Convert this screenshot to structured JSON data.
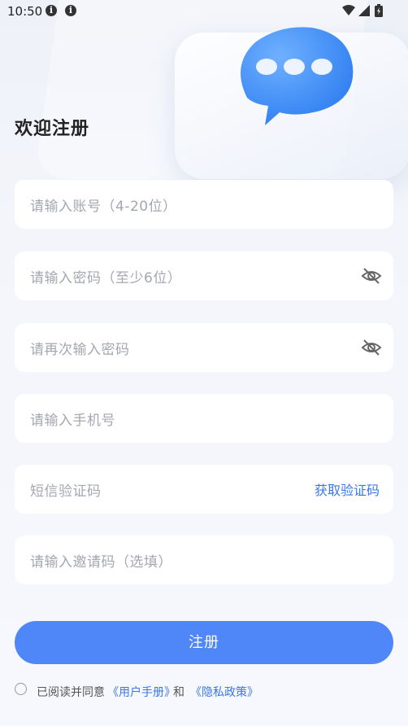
{
  "status_bar": {
    "time": "10:50"
  },
  "title": "欢迎注册",
  "fields": {
    "account": {
      "placeholder": "请输入账号（4-20位）"
    },
    "password": {
      "placeholder": "请输入密码（至少6位）"
    },
    "confirm_password": {
      "placeholder": "请再次输入密码"
    },
    "phone": {
      "placeholder": "请输入手机号"
    },
    "sms_code": {
      "placeholder": "短信验证码",
      "action": "获取验证码"
    },
    "invite_code": {
      "placeholder": "请输入邀请码（选填）"
    }
  },
  "register_button": "注册",
  "agreement": {
    "prefix": "已阅读并同意",
    "user_manual": "《用户手册》",
    "and": "和",
    "privacy": "《隐私政策》"
  },
  "colors": {
    "accent": "#4f87f9",
    "link": "#3a78e8"
  }
}
